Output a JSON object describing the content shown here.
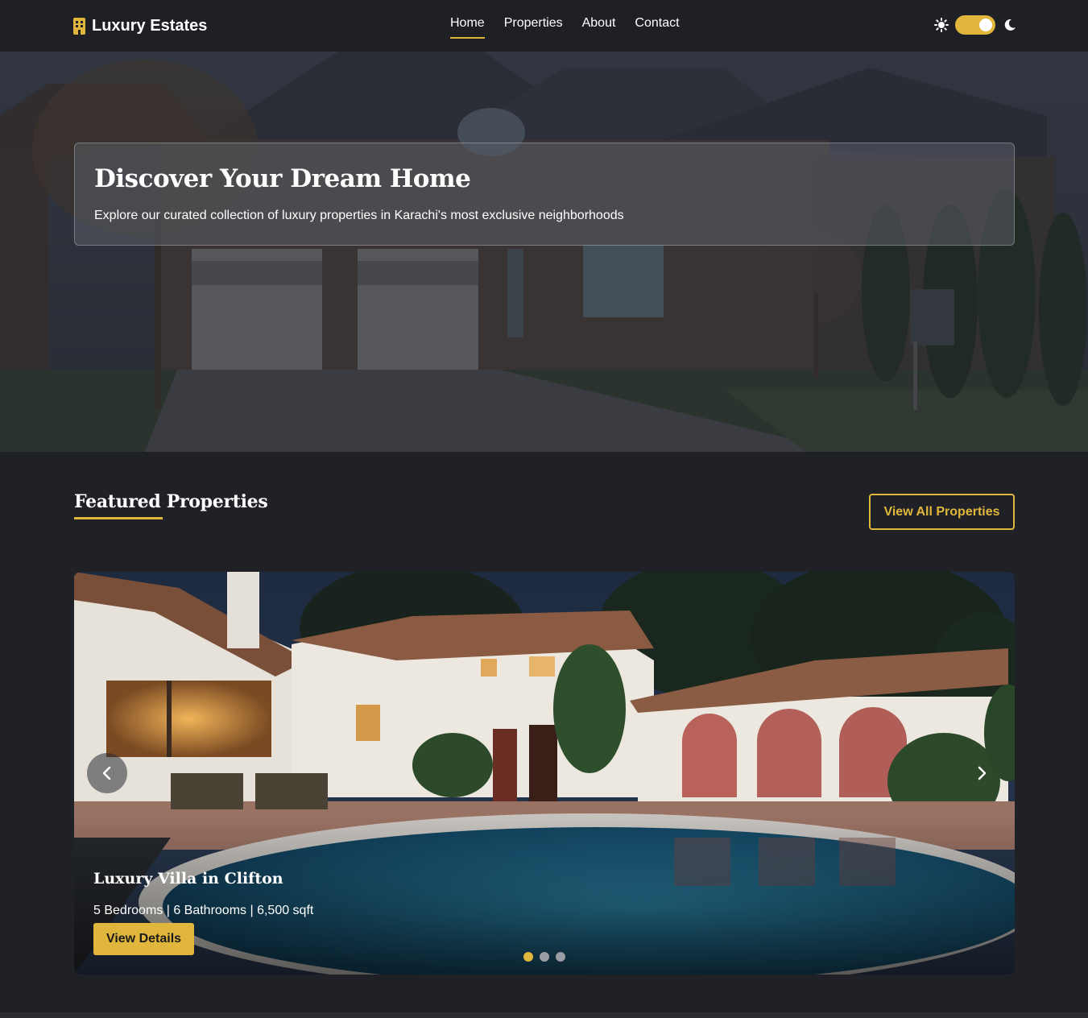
{
  "brand": {
    "name": "Luxury Estates",
    "icon": "building-icon"
  },
  "nav": {
    "items": [
      {
        "label": "Home",
        "active": true
      },
      {
        "label": "Properties",
        "active": false
      },
      {
        "label": "About",
        "active": false
      },
      {
        "label": "Contact",
        "active": false
      }
    ]
  },
  "theme_toggle": {
    "light_icon": "sun-icon",
    "dark_icon": "moon-icon",
    "state": "on"
  },
  "hero": {
    "title": "Discover Your Dream Home",
    "subtitle": "Explore our curated collection of luxury properties in Karachi's most exclusive neighborhoods"
  },
  "featured": {
    "title": "Featured Properties",
    "view_all_label": "View All Properties"
  },
  "carousel": {
    "slide": {
      "title": "Luxury Villa in Clifton",
      "meta": "5 Bedrooms | 6 Bathrooms | 6,500 sqft",
      "button_label": "View Details"
    },
    "prev_icon": "chevron-left-icon",
    "next_icon": "chevron-right-icon",
    "slide_count": 3,
    "active_index": 0
  },
  "colors": {
    "accent": "#e0b63c",
    "background": "#1f2126",
    "navbar": "#1e2025"
  }
}
